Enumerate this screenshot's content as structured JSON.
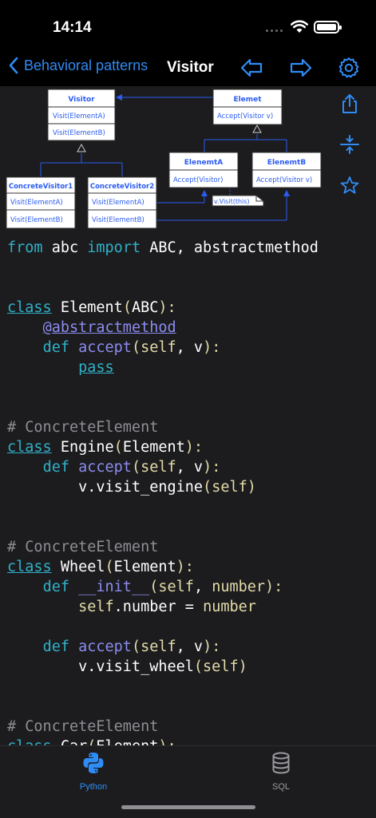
{
  "status": {
    "time": "14:14"
  },
  "nav": {
    "back_label": "Behavioral patterns",
    "title": "Visitor"
  },
  "diagram": {
    "visitor": {
      "title": "Visitor",
      "methods": [
        "Visit(ElementA)",
        "Visit(ElementB)"
      ]
    },
    "element": {
      "title": "Elemet",
      "methods": [
        "Accept(Visitor v)"
      ]
    },
    "concrete_visitor1": {
      "title": "ConcreteVisitor1",
      "methods": [
        "Visit(ElementA)",
        "Visit(ElementB)"
      ]
    },
    "concrete_visitor2": {
      "title": "ConcreteVisitor2",
      "methods": [
        "Visit(ElementA)",
        "Visit(ElementB)"
      ]
    },
    "element_a": {
      "title": "ElenemtA",
      "methods": [
        "Accept(Visitor)"
      ]
    },
    "element_b": {
      "title": "ElenemtB",
      "methods": [
        "Accept(Visitor v)"
      ]
    },
    "note": "v.Visit(this)"
  },
  "code": {
    "l1": {
      "kw1": "from",
      "mod": " abc ",
      "kw2": "import",
      "rest": " ABC, abstractmethod"
    },
    "l4": {
      "kw": "class",
      "name": " Element",
      "p1": "(",
      "base": "ABC",
      "p2": "):"
    },
    "l5": {
      "deco": "@abstractmethod"
    },
    "l6": {
      "kw": "def",
      "fn": " accept",
      "p1": "(",
      "self": "self",
      "sep": ", v",
      "p2": "):"
    },
    "l7": {
      "kw": "pass"
    },
    "l10": {
      "c": "# ConcreteElement"
    },
    "l11": {
      "kw": "class",
      "name": " Engine",
      "p1": "(",
      "base": "Element",
      "p2": "):"
    },
    "l12": {
      "kw": "def",
      "fn": " accept",
      "p1": "(",
      "self": "self",
      "sep": ", v",
      "p2": "):"
    },
    "l13": {
      "a": "v.visit_engine",
      "p1": "(",
      "self": "self",
      "p2": ")"
    },
    "l16": {
      "c": "# ConcreteElement"
    },
    "l17": {
      "kw": "class",
      "name": " Wheel",
      "p1": "(",
      "base": "Element",
      "p2": "):"
    },
    "l18": {
      "kw": "def",
      "fn": " __init__",
      "p1": "(",
      "self": "self",
      "sep": ", ",
      "arg": "number",
      "p2": "):"
    },
    "l19": {
      "self": "self",
      "a": ".number = ",
      "arg": "number"
    },
    "l21": {
      "kw": "def",
      "fn": " accept",
      "p1": "(",
      "self": "self",
      "sep": ", v",
      "p2": "):"
    },
    "l22": {
      "a": "v.visit_wheel",
      "p1": "(",
      "self": "self",
      "p2": ")"
    },
    "l25": {
      "c": "# ConcreteElement"
    },
    "l26": {
      "kw": "class",
      "name": " Car",
      "p1": "(",
      "base": "Element",
      "p2": "):"
    }
  },
  "tabs": [
    {
      "label": "Python",
      "icon": "python-icon",
      "active": true
    },
    {
      "label": "SQL",
      "icon": "database-icon",
      "active": false
    }
  ],
  "colors": {
    "accent": "#2f8cf5",
    "keyword": "#2fb1c9",
    "function": "#8c8cf0",
    "param": "#e3dba9",
    "comment": "#8e8e93",
    "background": "#1c1c1e"
  }
}
